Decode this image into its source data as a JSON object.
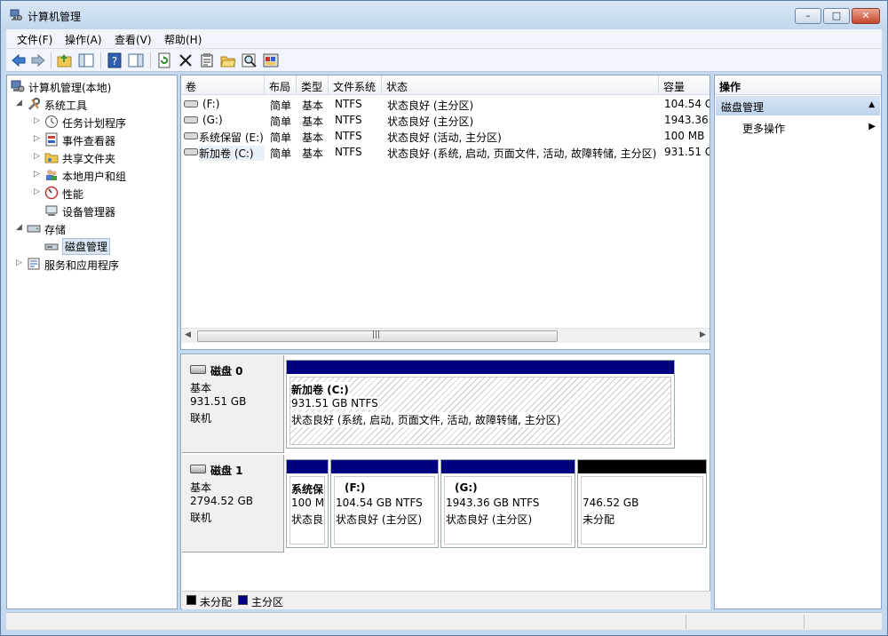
{
  "window": {
    "title": "计算机管理",
    "controls": {
      "minimize": "–",
      "maximize": "□",
      "close": "✕"
    }
  },
  "menu": [
    "文件(F)",
    "操作(A)",
    "查看(V)",
    "帮助(H)"
  ],
  "tree": {
    "root": "计算机管理(本地)",
    "system_tools": "系统工具",
    "task_scheduler": "任务计划程序",
    "event_viewer": "事件查看器",
    "shared_folders": "共享文件夹",
    "local_users": "本地用户和组",
    "performance": "性能",
    "device_manager": "设备管理器",
    "storage": "存储",
    "disk_management": "磁盘管理",
    "services_apps": "服务和应用程序"
  },
  "volumes": {
    "headers": [
      "卷",
      "布局",
      "类型",
      "文件系统",
      "状态",
      "容量"
    ],
    "rows": [
      {
        "name": "(F:)",
        "layout": "简单",
        "type": "基本",
        "fs": "NTFS",
        "status": "状态良好 (主分区)",
        "capacity": "104.54 G"
      },
      {
        "name": "(G:)",
        "layout": "简单",
        "type": "基本",
        "fs": "NTFS",
        "status": "状态良好 (主分区)",
        "capacity": "1943.36 ("
      },
      {
        "name": "系统保留 (E:)",
        "layout": "简单",
        "type": "基本",
        "fs": "NTFS",
        "status": "状态良好 (活动, 主分区)",
        "capacity": "100 MB"
      },
      {
        "name": "新加卷 (C:)",
        "layout": "简单",
        "type": "基本",
        "fs": "NTFS",
        "status": "状态良好 (系统, 启动, 页面文件, 活动, 故障转储, 主分区)",
        "capacity": "931.51 G"
      }
    ],
    "scroll_grip": "|||"
  },
  "disks": [
    {
      "name": "磁盘 0",
      "type": "基本",
      "size": "931.51 GB",
      "state": "联机",
      "partitions": [
        {
          "name": "新加卷  (C:)",
          "size": "931.51 GB NTFS",
          "status": "状态良好 (系统, 启动, 页面文件, 活动, 故障转储, 主分区)"
        }
      ]
    },
    {
      "name": "磁盘 1",
      "type": "基本",
      "size": "2794.52 GB",
      "state": "联机",
      "partitions": [
        {
          "name": "系统保",
          "size": "100 M",
          "status": "状态良"
        },
        {
          "name": "(F:)",
          "size": "104.54 GB NTFS",
          "status": "状态良好 (主分区)"
        },
        {
          "name": "(G:)",
          "size": "1943.36 GB NTFS",
          "status": "状态良好 (主分区)"
        },
        {
          "name": "",
          "size": "746.52 GB",
          "status": "未分配"
        }
      ]
    }
  ],
  "legend": {
    "unallocated": "未分配",
    "primary": "主分区"
  },
  "actions": {
    "title": "操作",
    "section": "磁盘管理",
    "more": "更多操作"
  },
  "colors": {
    "primary_partition": "#00007f",
    "unallocated": "#000000"
  }
}
